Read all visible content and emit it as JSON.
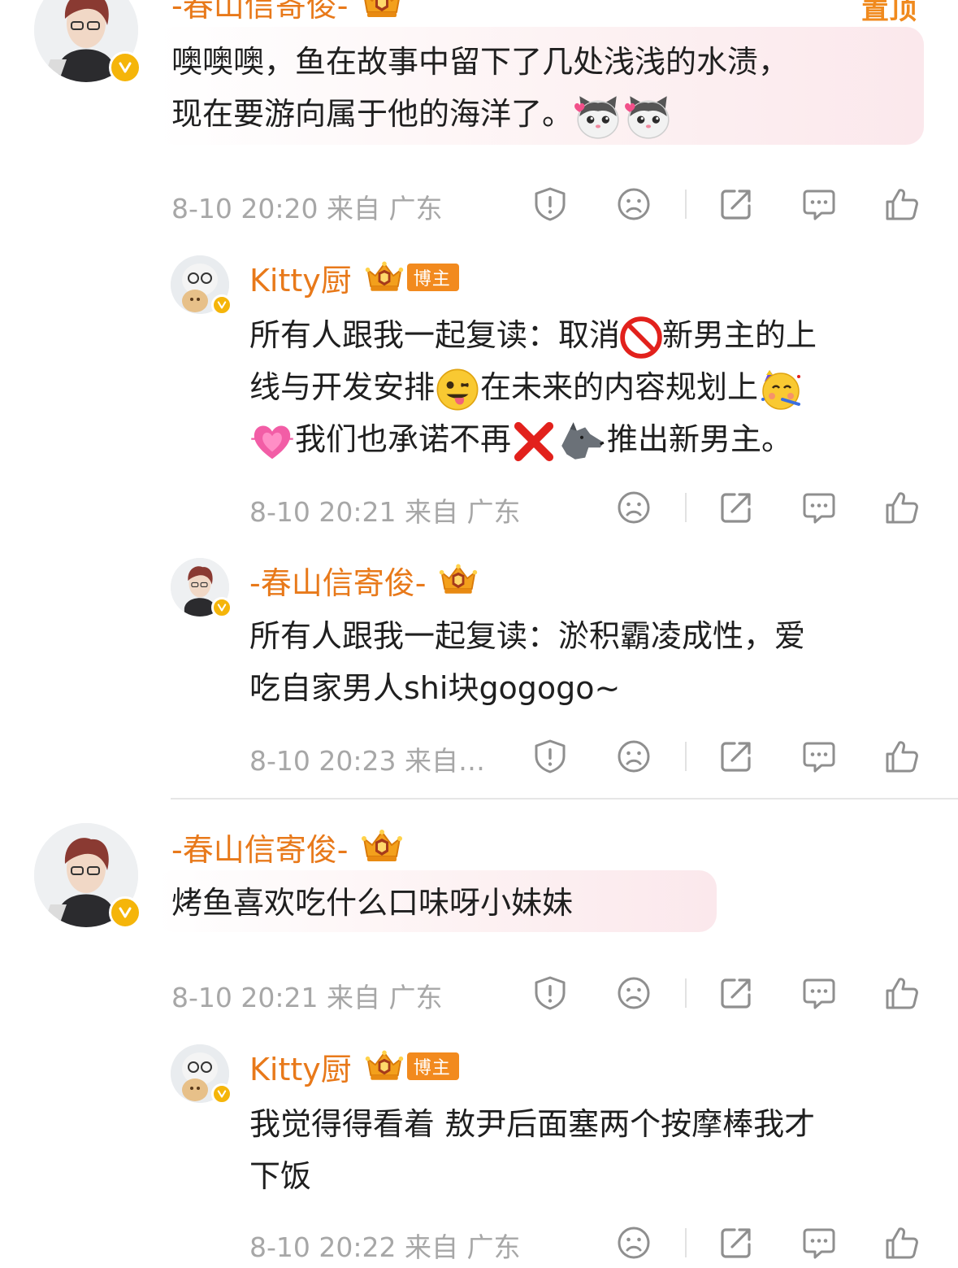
{
  "colors": {
    "username": "#e8791a",
    "meta": "#a7a7a7",
    "icon": "#8f8f8f",
    "vip": "#f5b50a"
  },
  "header_right": "置顶",
  "comments": [
    {
      "username": "-春山信寄俊-",
      "badge_level": "1",
      "text_line1": "噢噢噢，鱼在故事中留下了几处浅浅的水渍，",
      "text_line2": "现在要游向属于他的海洋了。",
      "emojis": [
        "cat-heart-emoji",
        "cat-heart-emoji"
      ],
      "meta": "8-10 20:20 来自 广东"
    },
    {
      "username": "Kitty厨",
      "badge_level": "6",
      "badge_label": "博主",
      "text_line1a": "所有人跟我一起复读：取消",
      "text_line1b": "新男主的上",
      "text_line2a": "线与开发安排",
      "text_line2b": "在未来的内容规划上",
      "text_line3a": "我们也承诺不再",
      "text_line3b": "推出新男主。",
      "emojis": [
        "no-entry-emoji",
        "winking-tongue-emoji",
        "partying-face-emoji",
        "growing-heart-emoji",
        "cross-mark-emoji",
        "wolf-emoji"
      ],
      "meta": "8-10 20:21 来自 广东"
    },
    {
      "username": "-春山信寄俊-",
      "badge_level": "1",
      "text_line1": "所有人跟我一起复读：淤积霸凌成性，爱",
      "text_line2": "吃自家男人shi块gogogo~",
      "meta": "8-10 20:23 来自…"
    },
    {
      "username": "-春山信寄俊-",
      "badge_level": "1",
      "text_line1": "烤鱼喜欢吃什么口味呀小妹妹",
      "meta": "8-10 20:21 来自 广东"
    },
    {
      "username": "Kitty厨",
      "badge_level": "6",
      "badge_label": "博主",
      "text_line1": "我觉得得看着 敖尹后面塞两个按摩棒我才",
      "text_line2": "下饭",
      "meta": "8-10 20:22 来自 广东"
    }
  ]
}
